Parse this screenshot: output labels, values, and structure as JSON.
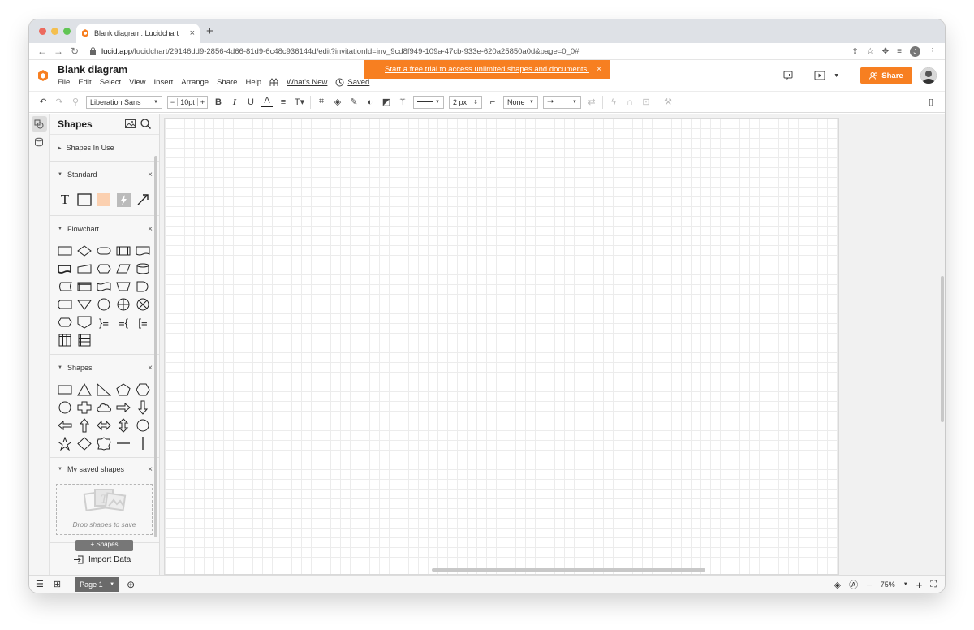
{
  "browser": {
    "tab_title": "Blank diagram: Lucidchart",
    "url_host": "lucid.app",
    "url_path": "/lucidchart/29146dd9-2856-4d66-81d9-6c48c936144d/edit?invitationId=inv_9cd8f949-109a-47cb-933e-620a25850a0d&page=0_0#",
    "profile_initial": "J"
  },
  "header": {
    "doc_title": "Blank diagram",
    "menu": [
      "File",
      "Edit",
      "Select",
      "View",
      "Insert",
      "Arrange",
      "Share",
      "Help"
    ],
    "whats_new": "What's New",
    "saved": "Saved",
    "banner_text": "Start a free trial to access unlimited shapes and documents!",
    "banner_close": "×",
    "share_label": "Share"
  },
  "toolbar": {
    "font_family": "Liberation Sans",
    "font_size": "10pt",
    "line_width": "2 px",
    "line_start": "None"
  },
  "panel": {
    "title": "Shapes",
    "sections": {
      "in_use": "Shapes In Use",
      "standard": "Standard",
      "flowchart": "Flowchart",
      "shapes": "Shapes",
      "saved": "My saved shapes"
    },
    "drop_text": "Drop shapes to save",
    "add_shapes": "+ Shapes",
    "import_data": "Import Data"
  },
  "bottom": {
    "page_label": "Page 1",
    "zoom": "75%"
  },
  "colors": {
    "accent": "#f77f21",
    "standard_block": "#fbd0b0"
  }
}
